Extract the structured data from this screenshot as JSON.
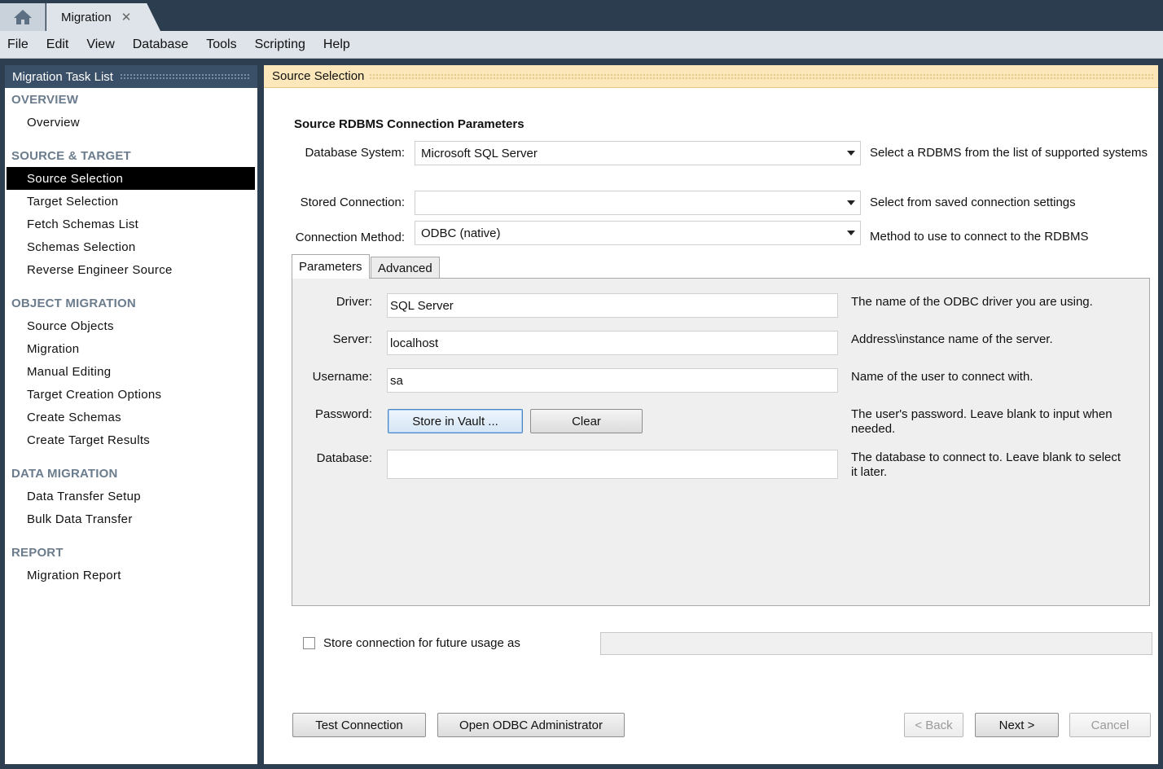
{
  "tabbar": {
    "home_icon": "home-icon",
    "document_tab": "Migration",
    "close_glyph": "✕"
  },
  "menu": [
    "File",
    "Edit",
    "View",
    "Database",
    "Tools",
    "Scripting",
    "Help"
  ],
  "task_list": {
    "title": "Migration Task List",
    "sections": {
      "overview": {
        "title": "OVERVIEW",
        "items": [
          "Overview"
        ]
      },
      "source_target": {
        "title": "SOURCE & TARGET",
        "items": [
          "Source Selection",
          "Target Selection",
          "Fetch Schemas List",
          "Schemas Selection",
          "Reverse Engineer Source"
        ]
      },
      "object_migration": {
        "title": "OBJECT MIGRATION",
        "items": [
          "Source Objects",
          "Migration",
          "Manual Editing",
          "Target Creation Options",
          "Create Schemas",
          "Create Target Results"
        ]
      },
      "data_migration": {
        "title": "DATA MIGRATION",
        "items": [
          "Data Transfer Setup",
          "Bulk Data Transfer"
        ]
      },
      "report": {
        "title": "REPORT",
        "items": [
          "Migration Report"
        ]
      }
    },
    "active_item": "Source Selection"
  },
  "page": {
    "header": "Source Selection",
    "heading": "Source RDBMS Connection Parameters",
    "database_system": {
      "label": "Database System:",
      "value": "Microsoft SQL Server",
      "help": "Select a RDBMS from the list of supported systems"
    },
    "stored_connection": {
      "label": "Stored Connection:",
      "value": "",
      "help": "Select from saved connection settings"
    },
    "connection_method": {
      "label": "Connection Method:",
      "value": "ODBC (native)",
      "help": "Method to use to connect to the RDBMS"
    },
    "tabs": {
      "parameters": "Parameters",
      "advanced": "Advanced"
    },
    "params": {
      "driver": {
        "label": "Driver:",
        "value": "SQL Server",
        "help": "The name of the ODBC driver you are using."
      },
      "server": {
        "label": "Server:",
        "value": "localhost",
        "help": "Address\\instance name of the server."
      },
      "username": {
        "label": "Username:",
        "value": "sa",
        "help": "Name of the user to connect with."
      },
      "password": {
        "label": "Password:",
        "store_button": "Store in Vault ...",
        "clear_button": "Clear",
        "help_line1": "The user's password. Leave blank to input when",
        "help_line2": "needed."
      },
      "database": {
        "label": "Database:",
        "value": "",
        "help_line1": "The database to connect to. Leave blank to select",
        "help_line2": "it later."
      }
    },
    "store_connection": {
      "label": "Store connection for future usage as",
      "checked": false,
      "value": ""
    },
    "buttons": {
      "test_connection": "Test Connection",
      "open_odbc_admin": "Open ODBC Administrator",
      "back": "< Back",
      "next": "Next >",
      "cancel": "Cancel"
    }
  }
}
